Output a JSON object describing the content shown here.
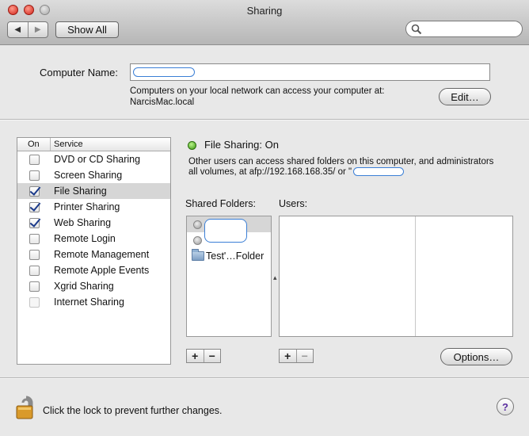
{
  "window": {
    "title": "Sharing"
  },
  "toolbar": {
    "back_glyph": "◀",
    "forward_glyph": "▶",
    "show_all_label": "Show All",
    "search_placeholder": ""
  },
  "computer_name": {
    "label": "Computer Name:",
    "value": "",
    "info_line1": "Computers on your local network can access your computer at:",
    "info_line2": "NarcisMac.local",
    "edit_label": "Edit…"
  },
  "services": {
    "col_on": "On",
    "col_service": "Service",
    "items": [
      {
        "label": "DVD or CD Sharing",
        "checked": false,
        "selected": false,
        "enabled": true
      },
      {
        "label": "Screen Sharing",
        "checked": false,
        "selected": false,
        "enabled": true
      },
      {
        "label": "File Sharing",
        "checked": true,
        "selected": true,
        "enabled": true
      },
      {
        "label": "Printer Sharing",
        "checked": true,
        "selected": false,
        "enabled": true
      },
      {
        "label": "Web Sharing",
        "checked": true,
        "selected": false,
        "enabled": true
      },
      {
        "label": "Remote Login",
        "checked": false,
        "selected": false,
        "enabled": true
      },
      {
        "label": "Remote Management",
        "checked": false,
        "selected": false,
        "enabled": true
      },
      {
        "label": "Remote Apple Events",
        "checked": false,
        "selected": false,
        "enabled": true
      },
      {
        "label": "Xgrid Sharing",
        "checked": false,
        "selected": false,
        "enabled": true
      },
      {
        "label": "Internet Sharing",
        "checked": false,
        "selected": false,
        "enabled": false
      }
    ]
  },
  "file_sharing": {
    "status": "File Sharing: On",
    "status_color": "#3c9a12",
    "desc_line1": "Other users can access shared folders on this computer, and administrators",
    "desc_line2": "all volumes, at afp://192.168.168.35/ or \""
  },
  "shared_folders": {
    "label": "Shared Folders:",
    "items": [
      {
        "name": "",
        "selected": true
      },
      {
        "name": "",
        "selected": false
      },
      {
        "name": "Test'…Folder",
        "selected": false
      }
    ]
  },
  "users": {
    "label": "Users:"
  },
  "buttons": {
    "plus": "+",
    "minus": "−",
    "options_label": "Options…"
  },
  "footer": {
    "lock_text": "Click the lock to prevent further changes.",
    "help_glyph": "?"
  }
}
